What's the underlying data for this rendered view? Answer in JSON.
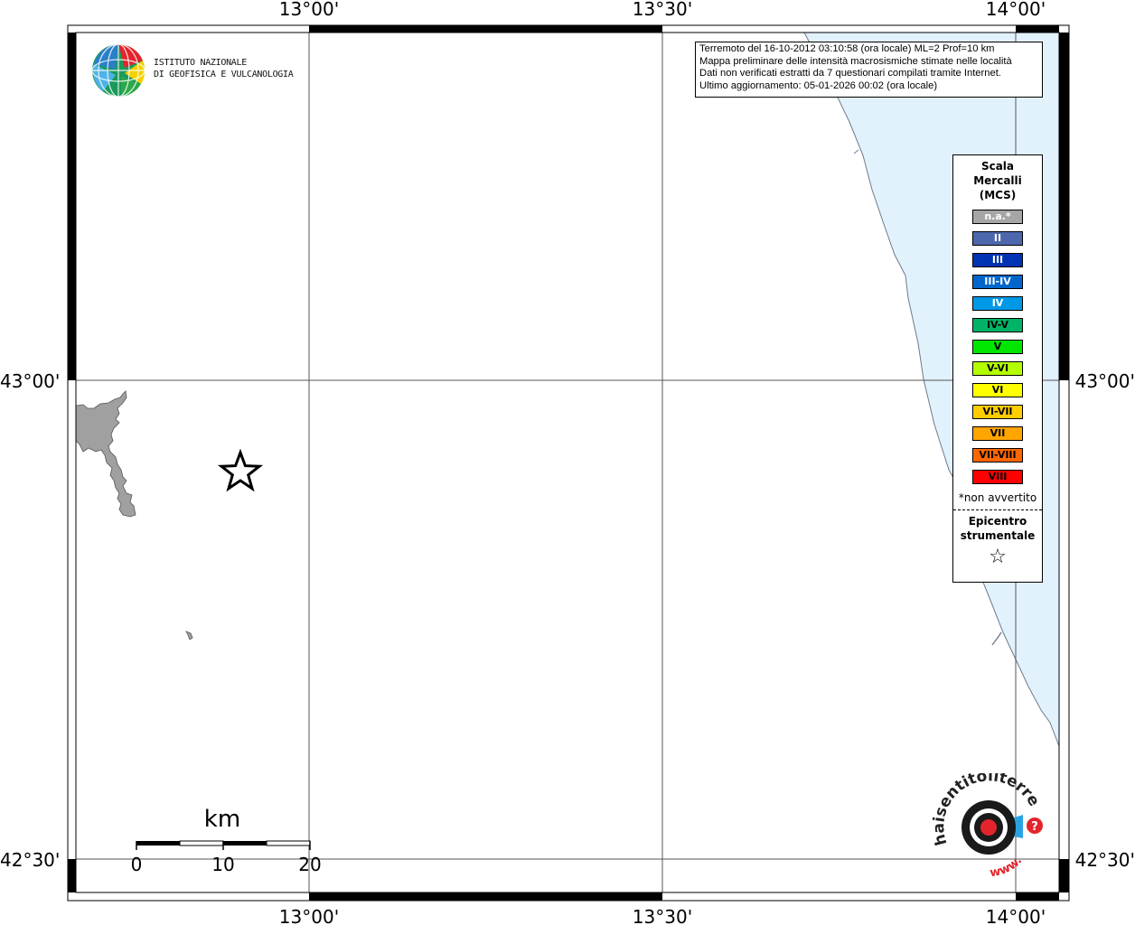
{
  "map": {
    "lon_ticks": [
      "13°00'",
      "13°30'",
      "14°00'"
    ],
    "lat_ticks": [
      "43°00'",
      "42°30'"
    ],
    "scale": {
      "unit": "km",
      "labels": [
        "0",
        "10",
        "20"
      ]
    }
  },
  "info_box": {
    "lines": [
      "Terremoto del 16-10-2012 03:10:58 (ora locale) ML=2 Prof=10 km",
      "Mappa preliminare delle intensità macrosismiche stimate nelle località",
      "Dati non verificati estratti da 7 questionari compilati tramite Internet.",
      "Ultimo aggiornamento: 05-01-2026 00:02 (ora locale)"
    ]
  },
  "legend": {
    "title_lines": [
      "Scala",
      "Mercalli",
      "(MCS)"
    ],
    "items": [
      {
        "label": "n.a.*",
        "color": "#a6a6a6",
        "text_color": "#ffffff"
      },
      {
        "label": "II",
        "color": "#4d67ad",
        "text_color": "#ffffff"
      },
      {
        "label": "III",
        "color": "#0033b3",
        "text_color": "#ffffff"
      },
      {
        "label": "III-IV",
        "color": "#0066cc",
        "text_color": "#ffffff"
      },
      {
        "label": "IV",
        "color": "#0099e6",
        "text_color": "#ffffff"
      },
      {
        "label": "IV-V",
        "color": "#00b366",
        "text_color": "#000000"
      },
      {
        "label": "V",
        "color": "#00e600",
        "text_color": "#000000"
      },
      {
        "label": "V-VI",
        "color": "#b3ff00",
        "text_color": "#000000"
      },
      {
        "label": "VI",
        "color": "#ffff00",
        "text_color": "#000000"
      },
      {
        "label": "VI-VII",
        "color": "#ffcc00",
        "text_color": "#000000"
      },
      {
        "label": "VII",
        "color": "#ffa500",
        "text_color": "#000000"
      },
      {
        "label": "VII-VIII",
        "color": "#ff6600",
        "text_color": "#000000"
      },
      {
        "label": "VIII",
        "color": "#ff0000",
        "text_color": "#000000"
      }
    ],
    "note": "*non avvertito",
    "epicentre_lines": [
      "Epicentro",
      "strumentale"
    ]
  },
  "logos": {
    "ingv_lines": [
      "ISTITUTO NAZIONALE",
      "DI GEOFISICA E VULCANOLOGIA"
    ],
    "hsit_main": "haisentitoilterremoto.it",
    "hsit_www": "www."
  },
  "colors": {
    "sea": "#e2f2fd",
    "coast": "#6e7b8a",
    "land_patch": "#a0a0a0"
  }
}
